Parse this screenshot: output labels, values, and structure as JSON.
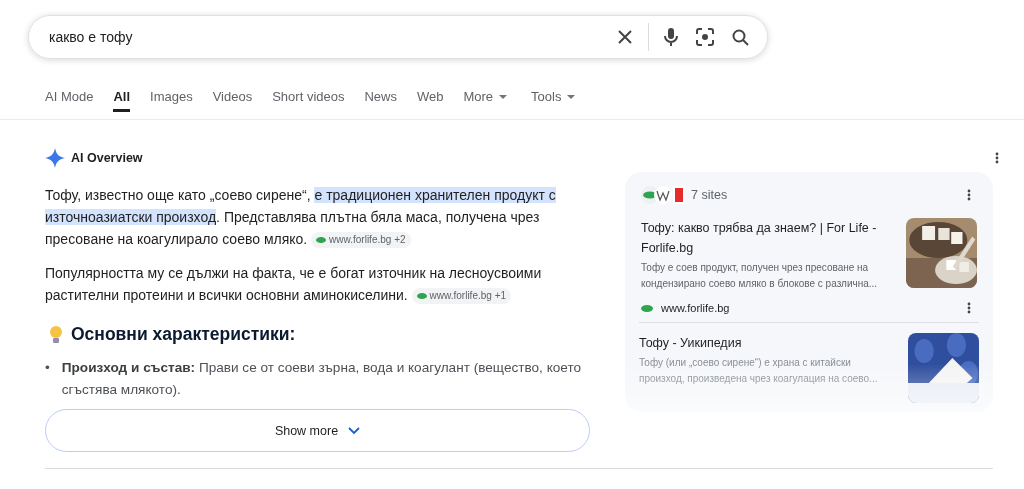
{
  "search": {
    "value": "какво е тофу"
  },
  "tabs": [
    {
      "label": "AI Mode",
      "selected": false,
      "dropdown": false
    },
    {
      "label": "All",
      "selected": true,
      "dropdown": false
    },
    {
      "label": "Images",
      "selected": false,
      "dropdown": false
    },
    {
      "label": "Videos",
      "selected": false,
      "dropdown": false
    },
    {
      "label": "Short videos",
      "selected": false,
      "dropdown": false
    },
    {
      "label": "News",
      "selected": false,
      "dropdown": false
    },
    {
      "label": "Web",
      "selected": false,
      "dropdown": false
    },
    {
      "label": "More",
      "selected": false,
      "dropdown": true
    },
    {
      "label": "Tools",
      "selected": false,
      "dropdown": true
    }
  ],
  "overview": {
    "title": "AI Overview",
    "paragraphs": [
      {
        "segments": [
          {
            "text": "Тофу, известно още като „соево сирене“, ",
            "highlighted": false
          },
          {
            "text": "е традиционен хранителен продукт с източноазиатски произход",
            "highlighted": true
          },
          {
            "text": ". Представлява плътна бяла маса, получена чрез пресоване на коагулирало соево мляко.",
            "highlighted": false
          }
        ],
        "source": {
          "site": "www.forlife.bg",
          "count": "+2"
        }
      },
      {
        "segments": [
          {
            "text": "Популярността му се дължи на факта, че е богат източник на лесноусвоими растителни протеини и всички основни аминокиселини.",
            "highlighted": false
          }
        ],
        "source": {
          "site": "www.forlife.bg",
          "count": "+1"
        }
      }
    ],
    "heading": "Основни характеристики:",
    "bullets": [
      {
        "marker": "•",
        "term": "Произход и състав:",
        "text": "Прави се от соеви зърна, вода и коагулант (вещество, което сгъстява млякото)."
      }
    ],
    "show_more": "Show more"
  },
  "sources": {
    "count": "7 sites",
    "items": [
      {
        "title": "Тофу: какво трябва да знаем? | For Life - Forlife.bg",
        "snippet": "Тофу е соев продукт, получен чрез пресоване на кондензирано соево мляко в блокове с различна...",
        "site": "www.forlife.bg",
        "faded": false
      },
      {
        "title": "Тофу - Уикипедия",
        "snippet": "Тофу (или „соево сирене“) е храна с китайски произход, произведена чрез коагулация на соево...",
        "faded": true
      }
    ]
  }
}
